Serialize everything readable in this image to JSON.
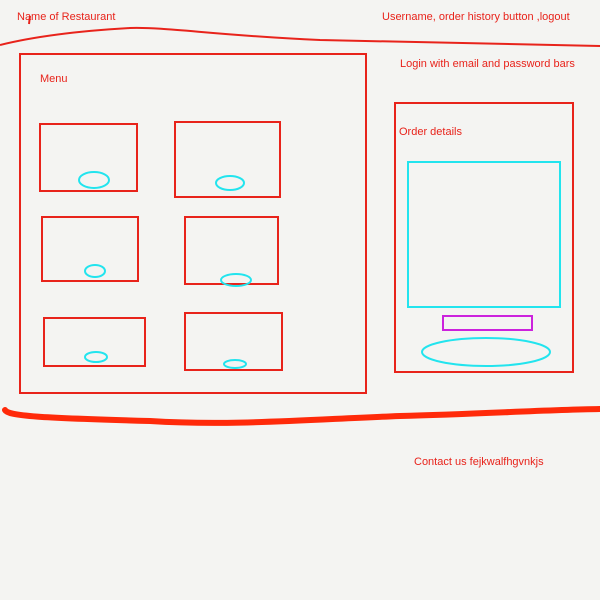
{
  "header": {
    "restaurant_name": "Name of Restaurant",
    "user_area": "Username, order history button ,logout",
    "login_area": "Login with email and password bars"
  },
  "menu": {
    "title": "Menu",
    "item_count": 6
  },
  "order": {
    "title": "Order details"
  },
  "footer": {
    "contact": "Contact us fejkwalfhgvnkjs"
  },
  "colors": {
    "sketch_red": "#e8231b",
    "sketch_cyan": "#22e4ee",
    "sketch_magenta": "#cc22dd",
    "background": "#f4f4f2"
  }
}
